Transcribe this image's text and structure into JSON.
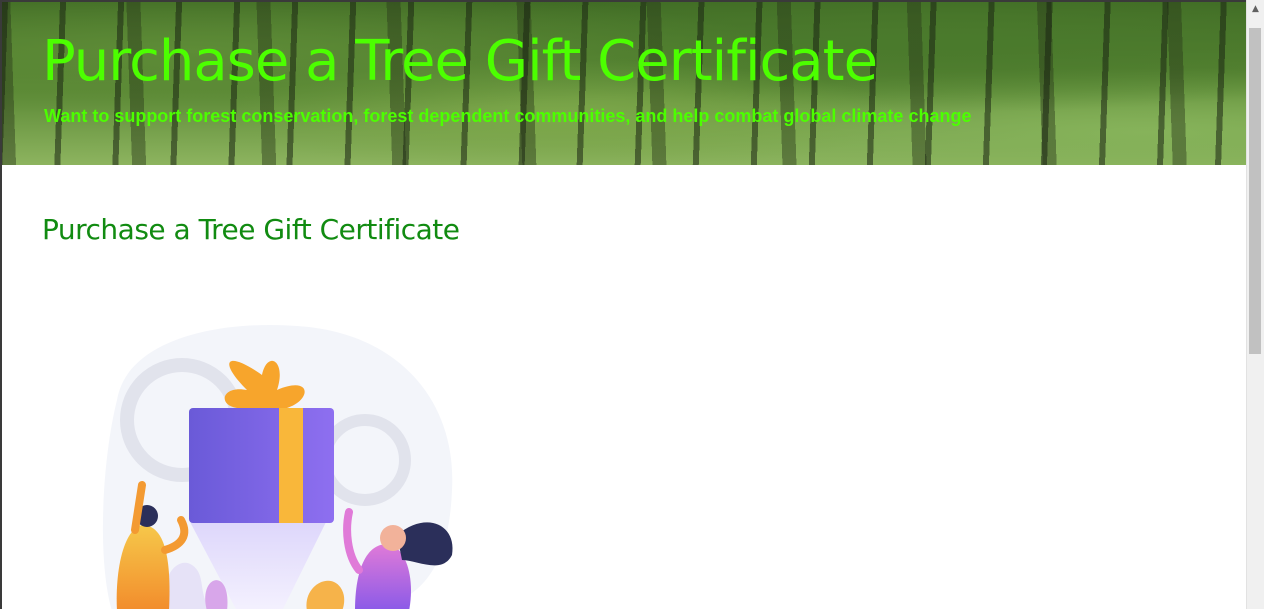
{
  "header": {
    "title": "Purchase a Tree Gift Certificate",
    "subtitle": "Want to support forest conservation, forest dependent communities, and help combat global climate change"
  },
  "main": {
    "heading": "Purchase a Tree Gift Certificate"
  },
  "colors": {
    "hero_text": "#4cff00",
    "heading": "#118b11",
    "gift_box": "#6f5ee0",
    "ribbon": "#f9b73a",
    "bow": "#f7a52c"
  },
  "icons": {
    "scroll_up": "chevron-up-icon",
    "illustration": "gift-people-illustration"
  },
  "scrollbar": {
    "up_glyph": "▲"
  }
}
